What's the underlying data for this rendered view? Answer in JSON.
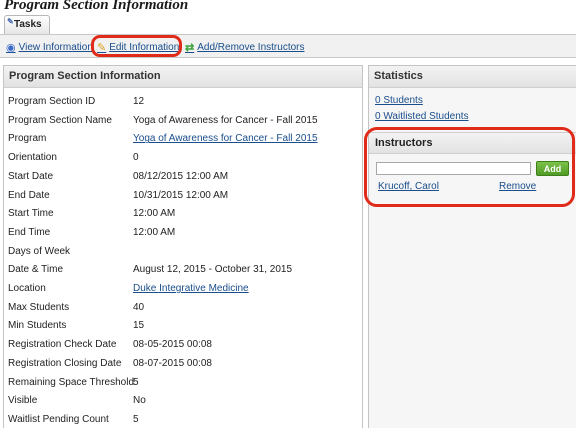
{
  "page": {
    "title": "Program Section Information"
  },
  "tabs": [
    {
      "label": "Tasks"
    }
  ],
  "toolbar": {
    "view_label": "View Information",
    "edit_label": "Edit Information",
    "instructors_label": "Add/Remove Instructors"
  },
  "details": {
    "heading": "Program Section Information",
    "rows": [
      {
        "label": "Program Section ID",
        "value": "12"
      },
      {
        "label": "Program Section Name",
        "value": "Yoga of Awareness for Cancer - Fall 2015"
      },
      {
        "label": "Program",
        "value": "Yoga of Awareness for Cancer - Fall 2015"
      },
      {
        "label": "Orientation",
        "value": "0"
      },
      {
        "label": "Start Date",
        "value": "08/12/2015 12:00 AM"
      },
      {
        "label": "End Date",
        "value": "10/31/2015 12:00 AM"
      },
      {
        "label": "Start Time",
        "value": "12:00 AM"
      },
      {
        "label": "End Time",
        "value": "12:00 AM"
      },
      {
        "label": "Days of Week",
        "value": ""
      },
      {
        "label": "Date & Time",
        "value": "August 12, 2015 - October 31, 2015"
      },
      {
        "label": "Location",
        "value": "Duke Integrative Medicine"
      },
      {
        "label": "Max Students",
        "value": "40"
      },
      {
        "label": "Min Students",
        "value": "15"
      },
      {
        "label": "Registration Check Date",
        "value": "08-05-2015 00:08"
      },
      {
        "label": "Registration Closing Date",
        "value": "08-07-2015 00:08"
      },
      {
        "label": "Remaining Space Threshold",
        "value": "5"
      },
      {
        "label": "Visible",
        "value": "No"
      },
      {
        "label": "Waitlist Pending Count",
        "value": "5"
      }
    ]
  },
  "statistics": {
    "heading": "Statistics",
    "students": "0 Students",
    "waitlisted": "0 Waitlisted Students"
  },
  "instructors": {
    "heading": "Instructors",
    "input_value": "",
    "add_label": "Add",
    "list": [
      {
        "name": "Krucoff, Carol",
        "remove_label": "Remove"
      }
    ]
  },
  "icons": {
    "tab": "tasks-icon",
    "view": "eye-icon",
    "edit": "pencil-icon",
    "instructors": "swap-arrows-icon"
  },
  "colors": {
    "link": "#1a4e8c",
    "highlight": "#e02a1a",
    "add_button": "#5aa52c"
  }
}
